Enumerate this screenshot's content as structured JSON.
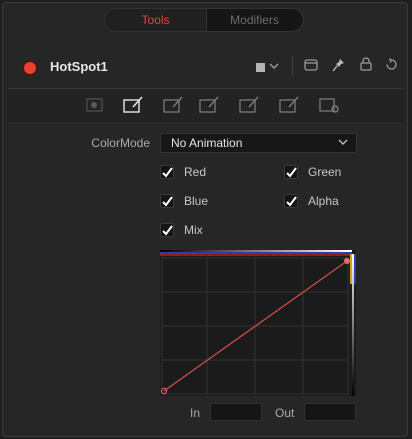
{
  "tabs": [
    {
      "label": "Tools",
      "active": true
    },
    {
      "label": "Modifiers",
      "active": false
    }
  ],
  "node": {
    "title": "HotSpot1",
    "power_color": "#e8412f",
    "header_icons": [
      "swatch-icon",
      "chevron-down-icon",
      "window-icon",
      "pin-icon",
      "lock-icon",
      "reset-icon"
    ]
  },
  "subtabs": [
    {
      "name": "hotspot-tab",
      "active": false
    },
    {
      "name": "color-curve-tab",
      "active": true
    },
    {
      "name": "edit-tab-3",
      "active": false
    },
    {
      "name": "edit-tab-4",
      "active": false
    },
    {
      "name": "edit-tab-5",
      "active": false
    },
    {
      "name": "edit-tab-6",
      "active": false
    },
    {
      "name": "settings-tab",
      "active": false
    }
  ],
  "colormode": {
    "label": "ColorMode",
    "value": "No Animation"
  },
  "channels": {
    "red": {
      "label": "Red",
      "checked": true
    },
    "green": {
      "label": "Green",
      "checked": true
    },
    "blue": {
      "label": "Blue",
      "checked": true
    },
    "alpha": {
      "label": "Alpha",
      "checked": true
    },
    "mix": {
      "label": "Mix",
      "checked": true
    }
  },
  "curve": {
    "line_color": "#c94c4c",
    "grid_divisions": 4
  },
  "io": {
    "in_label": "In",
    "out_label": "Out",
    "in_value": "",
    "out_value": ""
  }
}
